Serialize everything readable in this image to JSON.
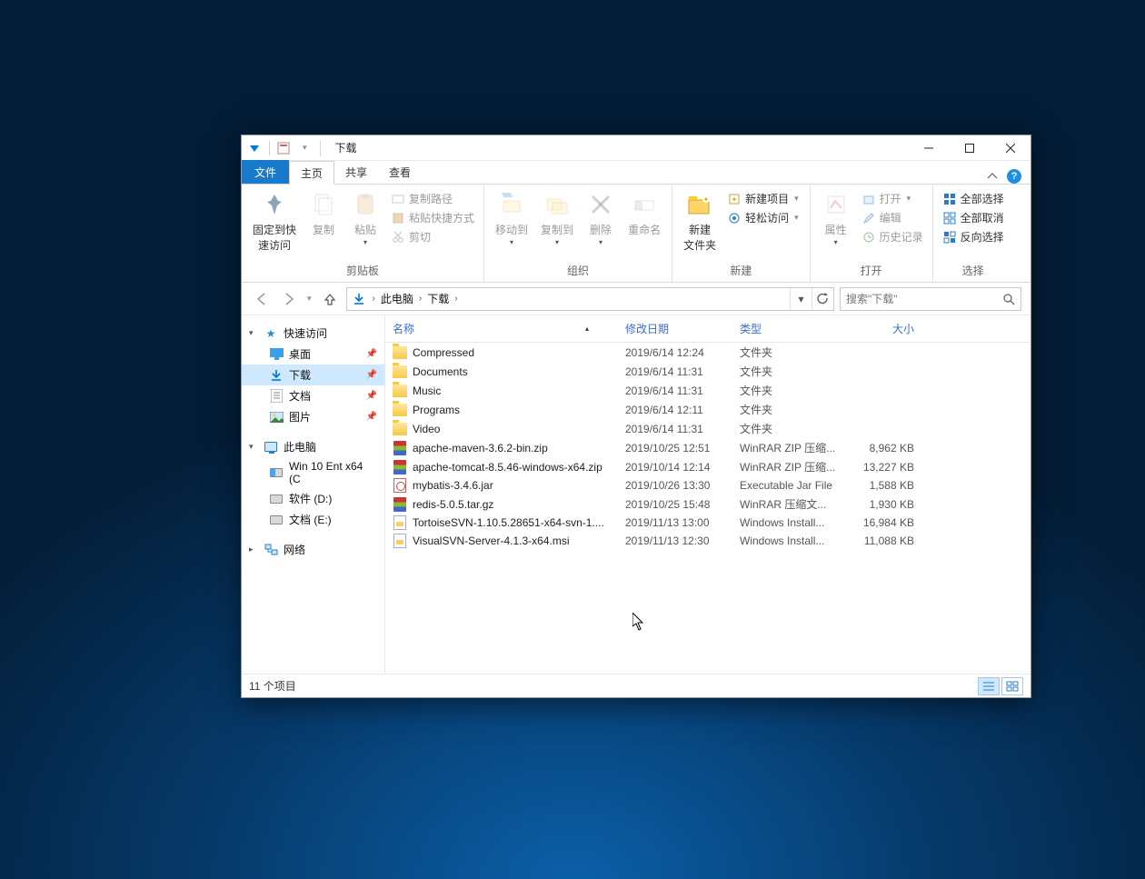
{
  "window": {
    "title": "下载"
  },
  "tabs": {
    "file": "文件",
    "home": "主页",
    "share": "共享",
    "view": "查看"
  },
  "ribbon": {
    "clipboard": {
      "pin": "固定到快\n速访问",
      "copy": "复制",
      "paste": "粘贴",
      "copy_path": "复制路径",
      "paste_shortcut": "粘贴快捷方式",
      "cut": "剪切",
      "label": "剪贴板"
    },
    "organize": {
      "move_to": "移动到",
      "copy_to": "复制到",
      "delete": "删除",
      "rename": "重命名",
      "label": "组织"
    },
    "new": {
      "new_folder": "新建\n文件夹",
      "new_item": "新建项目",
      "easy_access": "轻松访问",
      "label": "新建"
    },
    "open": {
      "properties": "属性",
      "open": "打开",
      "edit": "编辑",
      "history": "历史记录",
      "label": "打开"
    },
    "select": {
      "select_all": "全部选择",
      "select_none": "全部取消",
      "invert": "反向选择",
      "label": "选择"
    }
  },
  "breadcrumb": {
    "root": "此电脑",
    "current": "下载"
  },
  "search": {
    "placeholder": "搜索\"下载\""
  },
  "sidebar": {
    "quick": "快速访问",
    "desktop": "桌面",
    "downloads": "下载",
    "documents": "文档",
    "pictures": "图片",
    "this_pc": "此电脑",
    "drive_c": "Win 10 Ent x64 (C",
    "drive_d": "软件 (D:)",
    "drive_e": "文档 (E:)",
    "network": "网络"
  },
  "columns": {
    "name": "名称",
    "date": "修改日期",
    "type": "类型",
    "size": "大小"
  },
  "files": [
    {
      "icon": "folder",
      "name": "Compressed",
      "date": "2019/6/14 12:24",
      "type": "文件夹",
      "size": ""
    },
    {
      "icon": "folder",
      "name": "Documents",
      "date": "2019/6/14 11:31",
      "type": "文件夹",
      "size": ""
    },
    {
      "icon": "folder",
      "name": "Music",
      "date": "2019/6/14 11:31",
      "type": "文件夹",
      "size": ""
    },
    {
      "icon": "folder",
      "name": "Programs",
      "date": "2019/6/14 12:11",
      "type": "文件夹",
      "size": ""
    },
    {
      "icon": "folder",
      "name": "Video",
      "date": "2019/6/14 11:31",
      "type": "文件夹",
      "size": ""
    },
    {
      "icon": "rar",
      "name": "apache-maven-3.6.2-bin.zip",
      "date": "2019/10/25 12:51",
      "type": "WinRAR ZIP 压缩...",
      "size": "8,962 KB"
    },
    {
      "icon": "rar",
      "name": "apache-tomcat-8.5.46-windows-x64.zip",
      "date": "2019/10/14 12:14",
      "type": "WinRAR ZIP 压缩...",
      "size": "13,227 KB"
    },
    {
      "icon": "jar",
      "name": "mybatis-3.4.6.jar",
      "date": "2019/10/26 13:30",
      "type": "Executable Jar File",
      "size": "1,588 KB"
    },
    {
      "icon": "rar",
      "name": "redis-5.0.5.tar.gz",
      "date": "2019/10/25 15:48",
      "type": "WinRAR 压缩文...",
      "size": "1,930 KB"
    },
    {
      "icon": "msi",
      "name": "TortoiseSVN-1.10.5.28651-x64-svn-1....",
      "date": "2019/11/13 13:00",
      "type": "Windows Install...",
      "size": "16,984 KB"
    },
    {
      "icon": "msi",
      "name": "VisualSVN-Server-4.1.3-x64.msi",
      "date": "2019/11/13 12:30",
      "type": "Windows Install...",
      "size": "11,088 KB"
    }
  ],
  "status": {
    "count": "11 个项目"
  }
}
